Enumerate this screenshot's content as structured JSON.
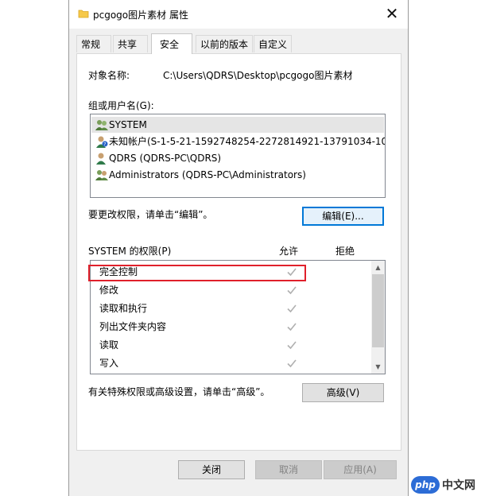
{
  "window": {
    "title": "pcgogo图片素材 属性",
    "close_icon": "close-x-icon"
  },
  "tabs": [
    {
      "label": "常规",
      "active": false
    },
    {
      "label": "共享",
      "active": false
    },
    {
      "label": "安全",
      "active": true
    },
    {
      "label": "以前的版本",
      "active": false
    },
    {
      "label": "自定义",
      "active": false
    }
  ],
  "security": {
    "object_name_label": "对象名称:",
    "object_name_value": "C:\\Users\\QDRS\\Desktop\\pcgogo图片素材",
    "group_label": "组或用户名(G):",
    "users": [
      {
        "label": "SYSTEM",
        "icon": "group-icon"
      },
      {
        "label": "未知帐户(S-1-5-21-1592748254-2272814921-13791034-10...",
        "icon": "unknown-user-icon"
      },
      {
        "label": "QDRS (QDRS-PC\\QDRS)",
        "icon": "user-icon"
      },
      {
        "label": "Administrators (QDRS-PC\\Administrators)",
        "icon": "group-icon"
      }
    ],
    "edit_hint": "要更改权限，请单击“编辑”。",
    "edit_button": "编辑(E)...",
    "perm_header": "SYSTEM 的权限(P)",
    "allow_header": "允许",
    "deny_header": "拒绝",
    "permissions": [
      {
        "label": "完全控制",
        "allow": true,
        "deny": false
      },
      {
        "label": "修改",
        "allow": true,
        "deny": false
      },
      {
        "label": "读取和执行",
        "allow": true,
        "deny": false
      },
      {
        "label": "列出文件夹内容",
        "allow": true,
        "deny": false
      },
      {
        "label": "读取",
        "allow": true,
        "deny": false
      },
      {
        "label": "写入",
        "allow": true,
        "deny": false
      }
    ],
    "advanced_hint": "有关特殊权限或高级设置，请单击“高级”。",
    "advanced_button": "高级(V)"
  },
  "footer": {
    "close_button": "关闭",
    "cancel_button": "取消",
    "apply_button": "应用(A)"
  },
  "watermark": {
    "badge": "php",
    "text": "中文网"
  },
  "colors": {
    "highlight_box": "#e0202b",
    "focus_border": "#0078d7",
    "check_gray": "#b0b0b0"
  }
}
